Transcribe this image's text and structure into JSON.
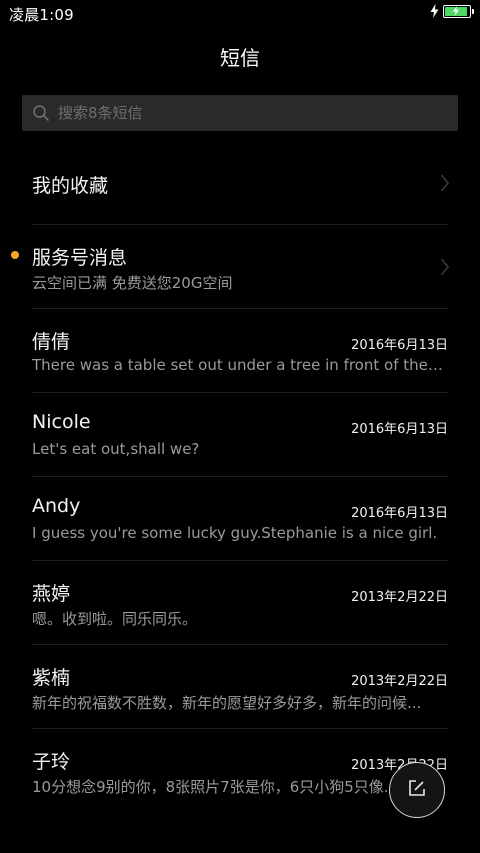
{
  "status_bar": {
    "time": "凌晨1:09",
    "battery_color": "#4cd964"
  },
  "header": {
    "title": "短信"
  },
  "search": {
    "placeholder": "搜索8条短信",
    "value": "",
    "icon": "search-icon"
  },
  "favorites": {
    "label": "我的收藏",
    "icon": "chevron-right-icon"
  },
  "service": {
    "title": "服务号消息",
    "subtitle": "云空间已满 免费送您20G空间",
    "unread_color": "#f5a623",
    "icon": "chevron-right-icon"
  },
  "conversations": [
    {
      "name": "倩倩",
      "date": "2016年6月13日",
      "preview": "There was a table set out under a tree in front of the ho..."
    },
    {
      "name": "Nicole",
      "date": "2016年6月13日",
      "preview": "Let's eat out,shall we?"
    },
    {
      "name": "Andy",
      "date": "2016年6月13日",
      "preview": "I guess you're some lucky guy.Stephanie is a nice girl."
    },
    {
      "name": "燕婷",
      "date": "2013年2月22日",
      "preview": "嗯。收到啦。同乐同乐。"
    },
    {
      "name": "紫楠",
      "date": "2013年2月22日",
      "preview": "新年的祝福数不胜数，新年的愿望好多好多，新年的问候..."
    },
    {
      "name": "子玲",
      "date": "2013年2月22日",
      "preview": "10分想念9别的你，8张照片7张是你，6只小狗5只像..."
    }
  ],
  "compose": {
    "icon": "compose-icon"
  }
}
